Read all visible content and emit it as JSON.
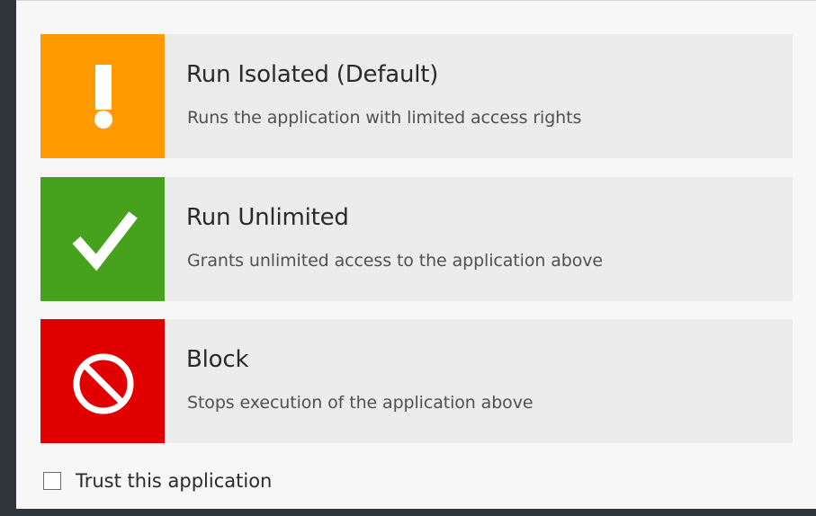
{
  "options": [
    {
      "title": "Run Isolated (Default)",
      "description": "Runs the application with limited access rights",
      "icon": "exclamation-icon",
      "color": "#ff9a00"
    },
    {
      "title": "Run Unlimited",
      "description": "Grants unlimited access to the application above",
      "icon": "checkmark-icon",
      "color": "#46a21c"
    },
    {
      "title": "Block",
      "description": "Stops execution of the application above",
      "icon": "block-icon",
      "color": "#e00000"
    }
  ],
  "trust": {
    "label": "Trust this application",
    "checked": false
  },
  "colors": {
    "option_background": "#ececec",
    "dialog_background": "#f7f7f7",
    "frame": "#2f343a"
  }
}
